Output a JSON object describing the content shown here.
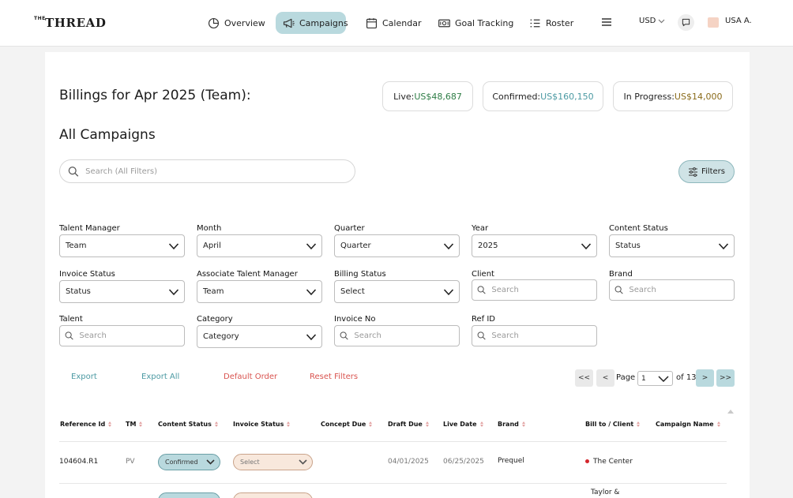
{
  "logo": {
    "small": "THE",
    "big": "THREAD"
  },
  "nav": {
    "items": [
      {
        "label": "Overview",
        "icon": "pie-chart-icon"
      },
      {
        "label": "Campaigns",
        "icon": "megaphone-icon",
        "active": true
      },
      {
        "label": "Calendar",
        "icon": "calendar-icon"
      },
      {
        "label": "Goal Tracking",
        "icon": "money-icon"
      },
      {
        "label": "Roster",
        "icon": "list-icon"
      }
    ],
    "currency": "USD",
    "user": "USA A."
  },
  "billing": {
    "title": "Billings for Apr 2025 (Team):",
    "live_label": "Live: ",
    "live_value": "US$48,687",
    "confirmed_label": "Confirmed: ",
    "confirmed_value": "US$160,150",
    "progress_label": "In Progress: ",
    "progress_value": "US$14,000"
  },
  "section_title": "All Campaigns",
  "search": {
    "placeholder": "Search (All Filters)"
  },
  "filters_button": "Filters",
  "filters": {
    "talent_manager": {
      "label": "Talent Manager",
      "value": "Team"
    },
    "month": {
      "label": "Month",
      "value": "April"
    },
    "quarter": {
      "label": "Quarter",
      "value": "Quarter"
    },
    "year": {
      "label": "Year",
      "value": "2025"
    },
    "content_status": {
      "label": "Content Status",
      "value": "Status"
    },
    "invoice_status": {
      "label": "Invoice Status",
      "value": "Status"
    },
    "associate_tm": {
      "label": "Associate Talent Manager",
      "value": "Team"
    },
    "billing_status": {
      "label": "Billing Status",
      "value": "Select"
    },
    "client": {
      "label": "Client",
      "placeholder": "Search"
    },
    "brand": {
      "label": "Brand",
      "placeholder": "Search"
    },
    "talent": {
      "label": "Talent",
      "placeholder": "Search"
    },
    "category": {
      "label": "Category",
      "value": "Category"
    },
    "invoice_no": {
      "label": "Invoice No",
      "placeholder": "Search"
    },
    "ref_id": {
      "label": "Ref ID",
      "placeholder": "Search"
    }
  },
  "actions": {
    "export": "Export",
    "export_all": "Export All",
    "default_order": "Default Order",
    "reset_filters": "Reset Filters"
  },
  "pagination": {
    "first": "<<",
    "prev": "<",
    "page_label": "Page",
    "current": "1",
    "of_label": "of 13",
    "next": ">",
    "last": ">>"
  },
  "table": {
    "headers": {
      "reference_id": "Reference Id",
      "tm": "TM",
      "content_status": "Content Status",
      "invoice_status": "Invoice Status",
      "concept_due": "Concept Due",
      "draft_due": "Draft Due",
      "live_date": "Live Date",
      "brand": "Brand",
      "bill_to": "Bill to / Client",
      "campaign_name": "Campaign Name"
    },
    "rows": [
      {
        "reference_id": "104604.R1",
        "tm": "PV",
        "content_status": "Confirmed",
        "invoice_status": "Select",
        "concept_due": "",
        "draft_due": "04/01/2025",
        "live_date": "06/25/2025",
        "brand": "Prequel",
        "bill_to": "The Center",
        "campaign_name": ""
      },
      {
        "bill_to": "Taylor &"
      }
    ]
  },
  "colors": {
    "accent": "#b9d9de",
    "link_teal": "#4c9aa3",
    "link_red": "#d9534f",
    "live_green": "#2e7d46",
    "progress_brown": "#8a6b1a"
  }
}
